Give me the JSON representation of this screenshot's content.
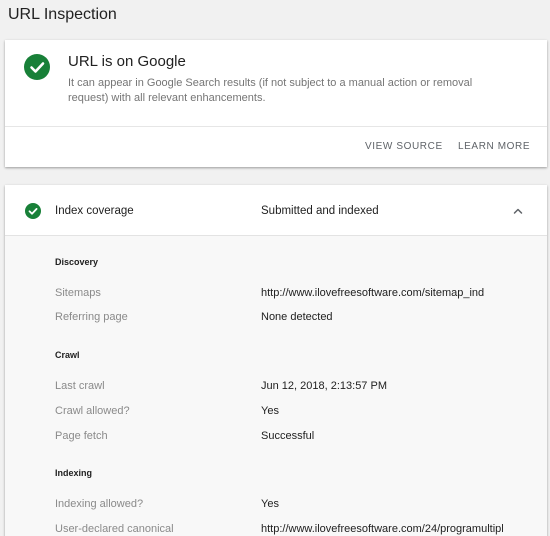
{
  "page": {
    "title": "URL Inspection"
  },
  "status_card": {
    "title": "URL is on Google",
    "description": "It can appear in Google Search results (if not subject to a manual action or removal request) with all relevant enhancements.",
    "view_source_label": "VIEW SOURCE",
    "learn_more_label": "LEARN MORE",
    "icon": "check-circle-icon",
    "accent_color": "#188038"
  },
  "detail_card": {
    "header": {
      "label": "Index coverage",
      "value": "Submitted and indexed",
      "expanded": true
    },
    "sections": [
      {
        "title": "Discovery",
        "rows": [
          {
            "label": "Sitemaps",
            "value": "http://www.ilovefreesoftware.com/sitemap_ind"
          },
          {
            "label": "Referring page",
            "value": "None detected"
          }
        ]
      },
      {
        "title": "Crawl",
        "rows": [
          {
            "label": "Last crawl",
            "value": "Jun 12, 2018, 2:13:57 PM"
          },
          {
            "label": "Crawl allowed?",
            "value": "Yes"
          },
          {
            "label": "Page fetch",
            "value": "Successful"
          }
        ]
      },
      {
        "title": "Indexing",
        "rows": [
          {
            "label": "Indexing allowed?",
            "value": "Yes"
          },
          {
            "label": "User-declared canonical",
            "value": "http://www.ilovefreesoftware.com/24/programultipl"
          }
        ]
      }
    ]
  }
}
